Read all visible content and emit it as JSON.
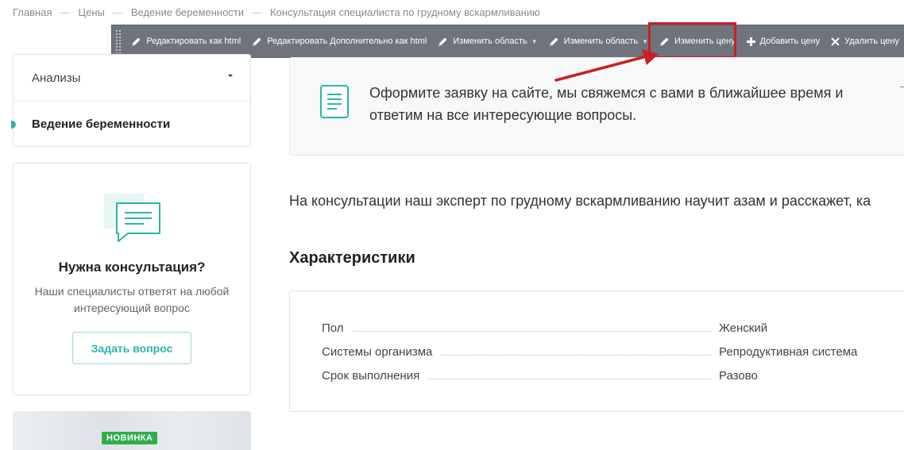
{
  "breadcrumb": {
    "items": [
      "Главная",
      "Цены",
      "Ведение беременности",
      "Консультация специалиста по грудному вскармливанию"
    ]
  },
  "toolbar": {
    "items": [
      {
        "label": "Редактировать как html",
        "icon": "pencil-icon"
      },
      {
        "label": "Редактировать Дополнительно как html",
        "icon": "pencil-icon"
      },
      {
        "label": "Изменить область",
        "icon": "pencil-icon",
        "has_dropdown": true
      },
      {
        "label": "Изменить область",
        "icon": "pencil-icon",
        "has_dropdown": true
      },
      {
        "label": "Изменить цену",
        "icon": "pencil-icon",
        "highlighted": true
      },
      {
        "label": "Добавить цену",
        "icon": "plus-icon"
      },
      {
        "label": "Удалить цену",
        "icon": "close-icon"
      }
    ],
    "highlight_color": "#c91f26"
  },
  "sidebar": {
    "menu": [
      {
        "label": "Анализы",
        "has_dropdown": true
      },
      {
        "label": "Ведение беременности",
        "active": true
      }
    ],
    "consult": {
      "title": "Нужна консультация?",
      "subtitle": "Наши специалисты ответят на любой интересующий вопрос",
      "button": "Задать вопрос"
    },
    "promo_badge": "НОВИНКА"
  },
  "main": {
    "notice": "Оформите заявку на сайте, мы свяжемся с вами в ближайшее время и ответим на все интересующие вопросы.",
    "intro": "На консультации наш эксперт по грудному вскармливанию научит азам и расскажет, ка",
    "characteristics_title": "Характеристики",
    "characteristics": [
      {
        "key": "Пол",
        "value": "Женский"
      },
      {
        "key": "Системы организма",
        "value": "Репродуктивная система"
      },
      {
        "key": "Срок выполнения",
        "value": "Разово"
      }
    ]
  },
  "colors": {
    "accent": "#2cb5ad",
    "toolbar_bg": "#6e737c",
    "badge": "#2fae4a"
  }
}
